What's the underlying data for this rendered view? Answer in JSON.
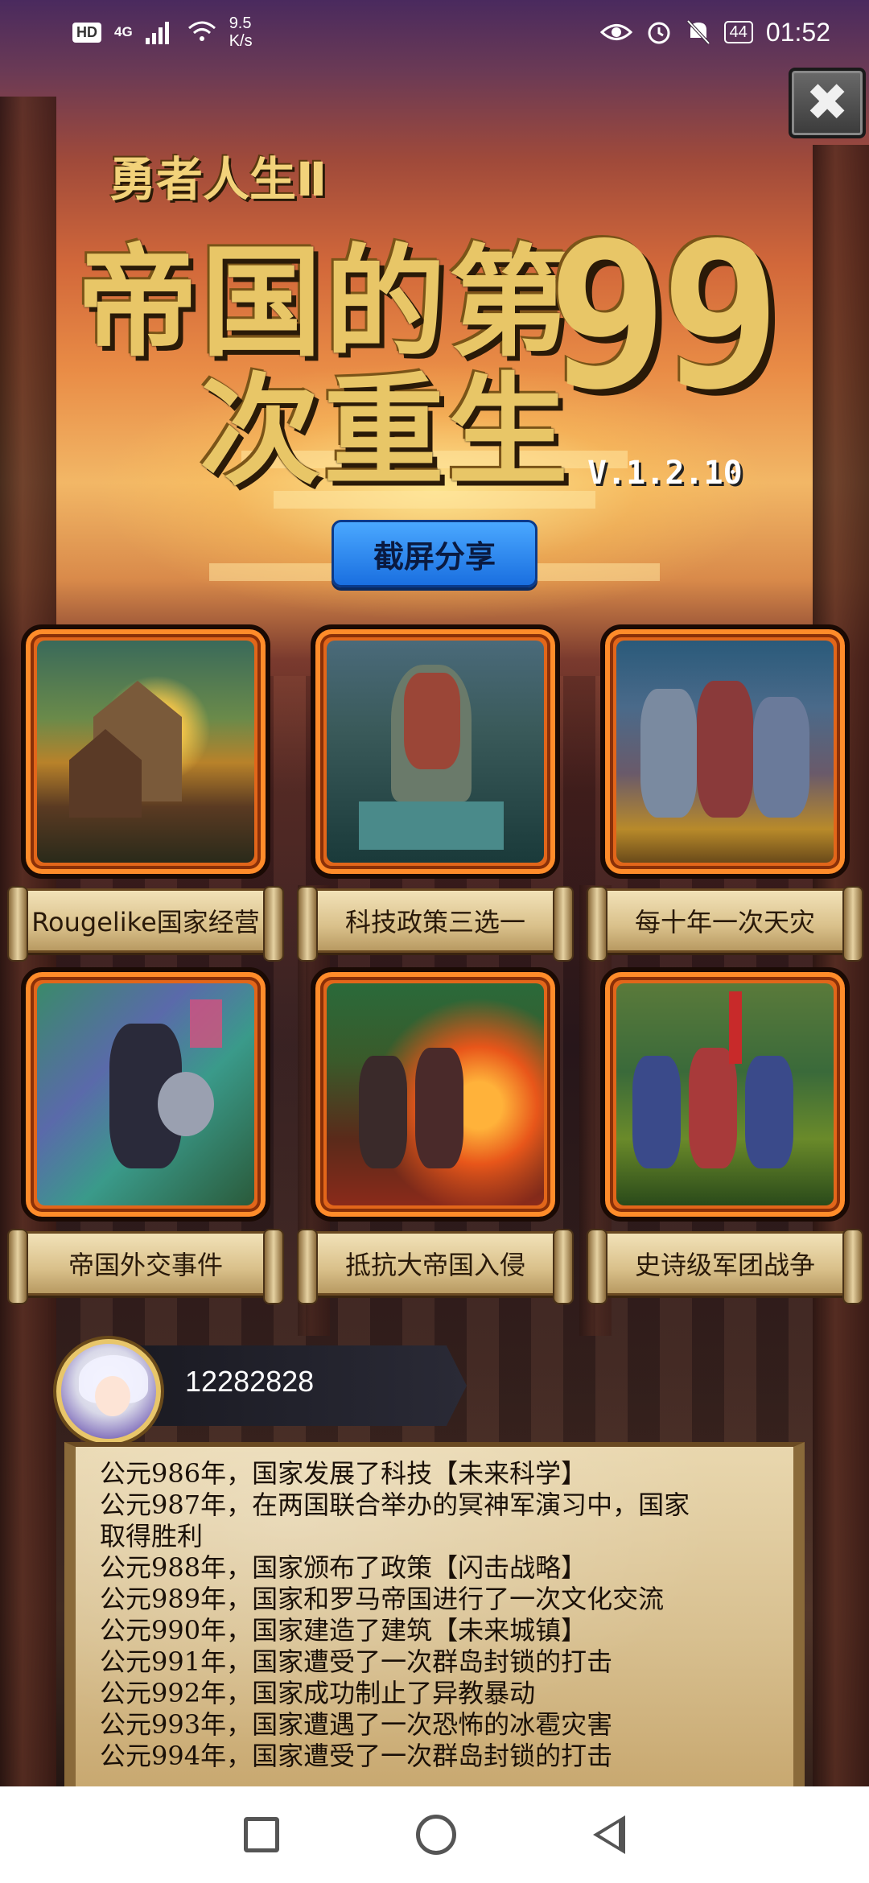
{
  "status_bar": {
    "hd": "HD",
    "network": "4G",
    "speed_value": "9.5",
    "speed_unit": "K/s",
    "battery": "44",
    "time": "01:52"
  },
  "close_button": {
    "label": "✖"
  },
  "title": {
    "subtitle": "勇者人生Ⅱ",
    "line1": "帝国的第",
    "line2": "次重生",
    "number": "99",
    "version": "V.1.2.10"
  },
  "share_button": {
    "label": "截屏分享"
  },
  "features": [
    {
      "label": "Rougelike国家经营",
      "art": "village"
    },
    {
      "label": "科技政策三选一",
      "art": "statue"
    },
    {
      "label": "每十年一次天灾",
      "art": "knights"
    },
    {
      "label": "帝国外交事件",
      "art": "warrior"
    },
    {
      "label": "抵抗大帝国入侵",
      "art": "fire"
    },
    {
      "label": "史诗级军团战争",
      "art": "army"
    }
  ],
  "player": {
    "id": "12282828"
  },
  "log": [
    "公元986年，国家发展了科技【未来科学】",
    "公元987年，在两国联合举办的冥神军演习中，国家",
    "取得胜利",
    "公元988年，国家颁布了政策【闪击战略】",
    "公元989年，国家和罗马帝国进行了一次文化交流",
    "公元990年，国家建造了建筑【未来城镇】",
    "公元991年，国家遭受了一次群岛封锁的打击",
    "公元992年，国家成功制止了异教暴动",
    "公元993年，国家遭遇了一次恐怖的冰雹灾害",
    "公元994年，国家遭受了一次群岛封锁的打击"
  ],
  "colors": {
    "gold": "#e8c667",
    "frame_orange": "#e2661a",
    "share_blue": "#1a6fe0",
    "parchment": "#d8c090"
  }
}
